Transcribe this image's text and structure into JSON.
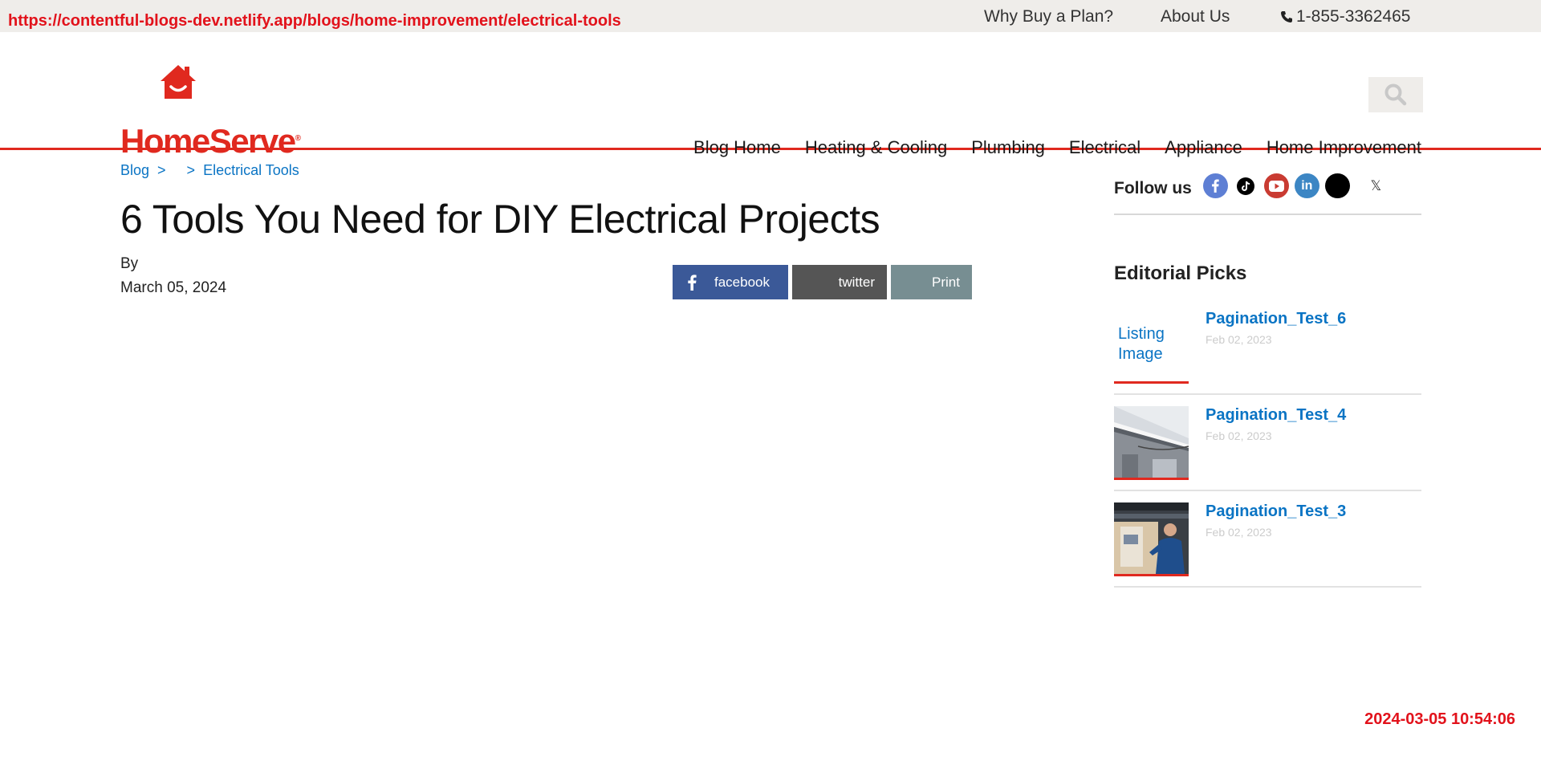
{
  "overlay": {
    "url": "https://contentful-blogs-dev.netlify.app/blogs/home-improvement/electrical-tools",
    "timestamp": "2024-03-05 10:54:06"
  },
  "utility": {
    "why_buy": "Why Buy a Plan?",
    "about": "About Us",
    "phone": "1-855-3362465"
  },
  "brand": {
    "name": "HomeServe",
    "reg": "®",
    "color": "#e0291f"
  },
  "nav": {
    "items": [
      {
        "label": "Blog Home"
      },
      {
        "label": "Heating & Cooling"
      },
      {
        "label": "Plumbing"
      },
      {
        "label": "Electrical"
      },
      {
        "label": "Appliance"
      },
      {
        "label": "Home Improvement"
      }
    ]
  },
  "breadcrumb": {
    "blog": "Blog",
    "sep": ">",
    "current": "Electrical Tools"
  },
  "article": {
    "title": "6 Tools You Need for DIY Electrical Projects",
    "by": "By",
    "date": "March 05, 2024"
  },
  "share": {
    "facebook": "facebook",
    "twitter": "twitter",
    "print": "Print"
  },
  "sidebar": {
    "follow_label": "Follow us",
    "social_icons": [
      "facebook-icon",
      "tiktok-icon",
      "youtube-icon",
      "linkedin-icon",
      "blank-icon",
      "x-icon"
    ],
    "picks_title": "Editorial Picks",
    "picks": [
      {
        "title": "Pagination_Test_6",
        "date": "Feb 02, 2023",
        "thumb_alt": "Listing Image"
      },
      {
        "title": "Pagination_Test_4",
        "date": "Feb 02, 2023"
      },
      {
        "title": "Pagination_Test_3",
        "date": "Feb 02, 2023"
      }
    ]
  },
  "colors": {
    "link_blue": "#0a74c4",
    "facebook": "#3b5998",
    "twitter": "#555555",
    "print": "#778e92"
  }
}
